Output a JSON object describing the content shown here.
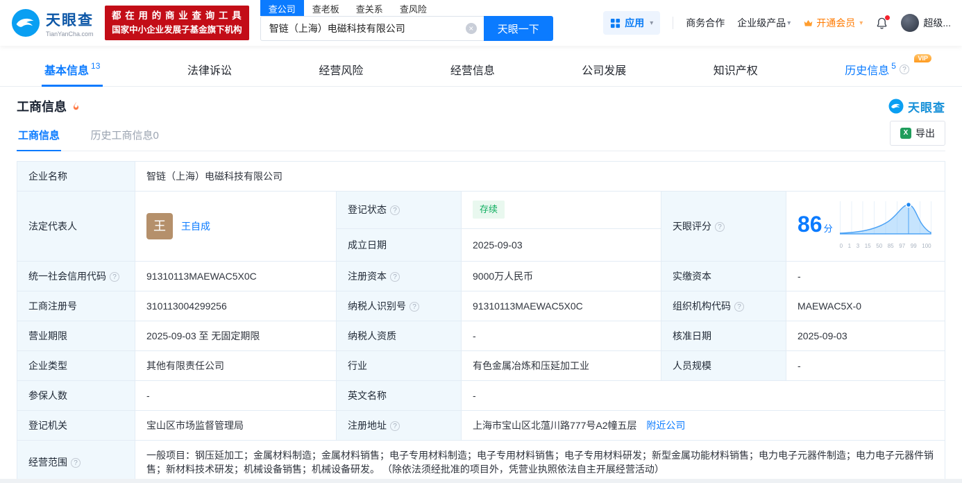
{
  "icons": {
    "help": "?",
    "caret": "▾",
    "clear": "×",
    "excel": "X"
  },
  "colors": {
    "primary": "#0b7bff",
    "banner_red": "#c30d17",
    "vip_orange": "#ff7a00",
    "status_green": "#0fae5f"
  },
  "header": {
    "logo": {
      "title": "天眼查",
      "subtitle": "TianYanCha.com"
    },
    "banner": {
      "line1": "都 在 用 的 商 业 查 询 工 具",
      "line2": "国家中小企业发展子基金旗下机构"
    },
    "search": {
      "tabs": [
        "查公司",
        "查老板",
        "查关系",
        "查风险"
      ],
      "value": "智链（上海）电磁科技有限公司",
      "button": "天眼一下"
    },
    "menu": {
      "apps": "应用",
      "cooperation": "商务合作",
      "enterprise": "企业级产品",
      "vip": "开通会员",
      "user": "超级..."
    }
  },
  "nav": {
    "tabs": [
      {
        "label": "基本信息",
        "count": "13"
      },
      {
        "label": "法律诉讼",
        "count": ""
      },
      {
        "label": "经营风险",
        "count": ""
      },
      {
        "label": "经营信息",
        "count": ""
      },
      {
        "label": "公司发展",
        "count": ""
      },
      {
        "label": "知识产权",
        "count": ""
      },
      {
        "label": "历史信息",
        "count": "5",
        "badge": "VIP"
      }
    ]
  },
  "section": {
    "title": "工商信息",
    "brand": "天眼查"
  },
  "subtabs": {
    "current": "工商信息",
    "history": "历史工商信息0",
    "export": "导出"
  },
  "table": {
    "company_name_label": "企业名称",
    "company_name": "智链（上海）电磁科技有限公司",
    "legal_rep_label": "法定代表人",
    "legal_rep_avatar": "王",
    "legal_rep_name": "王自成",
    "reg_status_label": "登记状态",
    "reg_status_value": "存续",
    "establish_date_label": "成立日期",
    "establish_date_value": "2025-09-03",
    "score_label": "天眼评分",
    "score_value": "86",
    "score_unit": "分",
    "score_axis": [
      "0",
      "1",
      "3",
      "15",
      "50",
      "85",
      "97",
      "99",
      "100"
    ],
    "credit_code_label": "统一社会信用代码",
    "credit_code_value": "91310113MAEWAC5X0C",
    "reg_capital_label": "注册资本",
    "reg_capital_value": "9000万人民币",
    "paid_capital_label": "实缴资本",
    "paid_capital_value": "-",
    "reg_number_label": "工商注册号",
    "reg_number_value": "310113004299256",
    "taxpayer_id_label": "纳税人识别号",
    "taxpayer_id_value": "91310113MAEWAC5X0C",
    "org_code_label": "组织机构代码",
    "org_code_value": "MAEWAC5X-0",
    "business_term_label": "营业期限",
    "business_term_value": "2025-09-03 至 无固定期限",
    "taxpayer_quality_label": "纳税人资质",
    "taxpayer_quality_value": "-",
    "approval_date_label": "核准日期",
    "approval_date_value": "2025-09-03",
    "company_type_label": "企业类型",
    "company_type_value": "其他有限责任公司",
    "industry_label": "行业",
    "industry_value": "有色金属冶炼和压延加工业",
    "staff_size_label": "人员规模",
    "staff_size_value": "-",
    "insured_count_label": "参保人数",
    "insured_count_value": "-",
    "english_name_label": "英文名称",
    "english_name_value": "-",
    "registry_authority_label": "登记机关",
    "registry_authority_value": "宝山区市场监督管理局",
    "address_label": "注册地址",
    "address_value": "上海市宝山区北蕰川路777号A2幢五层",
    "address_link": "附近公司",
    "business_scope_label": "经营范围",
    "business_scope_value": "一般项目：钢压延加工；金属材料制造；金属材料销售；电子专用材料制造；电子专用材料销售；电子专用材料研发；新型金属功能材料销售；电力电子元器件制造；电力电子元器件销售；新材料技术研发；机械设备销售；机械设备研发。 （除依法须经批准的项目外，凭营业执照依法自主开展经营活动）"
  }
}
